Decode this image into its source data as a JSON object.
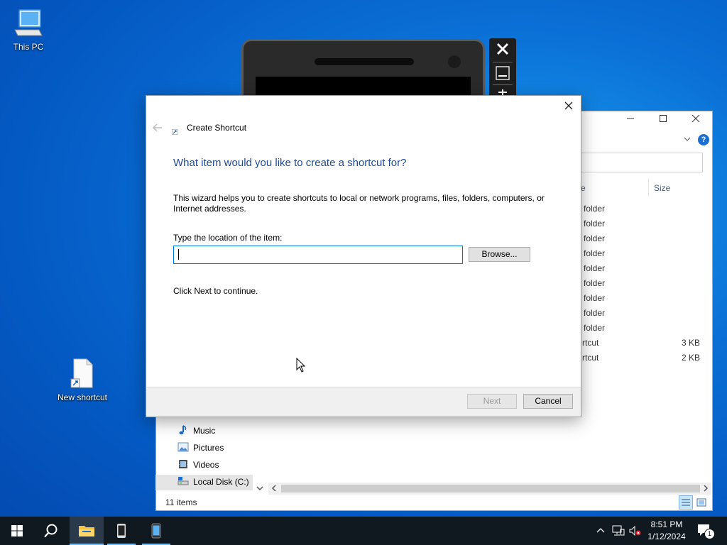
{
  "desktop": {
    "this_pc": "This PC",
    "new_shortcut": "New shortcut"
  },
  "explorer": {
    "column_name_partial": "e",
    "column_size": "Size",
    "rows": [
      {
        "type": "folder",
        "size": ""
      },
      {
        "type": "folder",
        "size": ""
      },
      {
        "type": "folder",
        "size": ""
      },
      {
        "type": "folder",
        "size": ""
      },
      {
        "type": "folder",
        "size": ""
      },
      {
        "type": "folder",
        "size": ""
      },
      {
        "type": "folder",
        "size": ""
      },
      {
        "type": "folder",
        "size": ""
      },
      {
        "type": "folder",
        "size": ""
      },
      {
        "type": "rtcut",
        "size": "3 KB"
      },
      {
        "type": "rtcut",
        "size": "2 KB"
      }
    ],
    "nav": [
      "Music",
      "Pictures",
      "Videos",
      "Local Disk (C:)"
    ],
    "status": "11 items",
    "help": "?"
  },
  "dialog": {
    "title": "Create Shortcut",
    "heading": "What item would you like to create a shortcut for?",
    "description": "This wizard helps you to create shortcuts to local or network programs, files, folders, computers, or Internet addresses.",
    "location_label": "Type the location of the item:",
    "location_value": "",
    "browse": "Browse...",
    "continue_text": "Click Next to continue.",
    "next": "Next",
    "cancel": "Cancel"
  },
  "taskbar": {
    "time": "8:51 PM",
    "date": "1/12/2024",
    "notification_count": "1"
  },
  "colors": {
    "accent": "#0078d7",
    "heading": "#1f4a93",
    "taskbar": "#101820"
  }
}
